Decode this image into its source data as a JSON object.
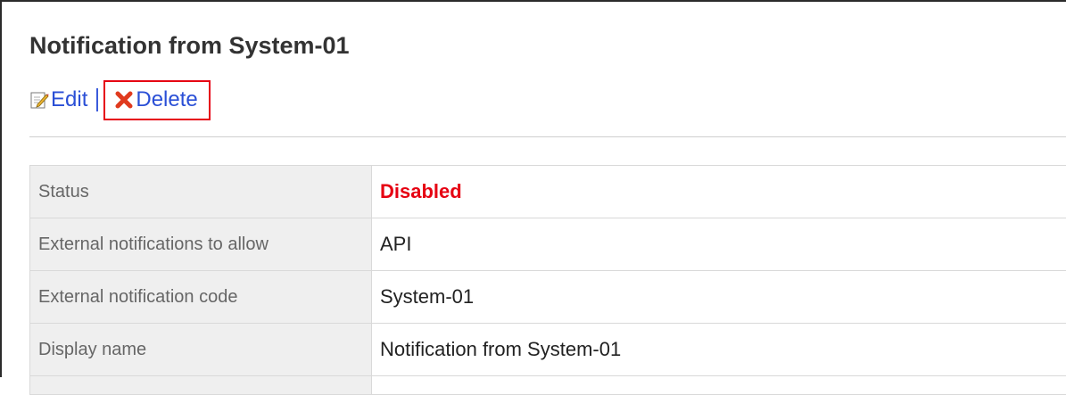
{
  "page": {
    "title": "Notification from System-01"
  },
  "actions": {
    "edit_label": "Edit",
    "edit_icon": "edit-icon",
    "delete_label": "Delete",
    "delete_icon": "delete-x-icon",
    "highlight_color": "#e60012"
  },
  "details": {
    "rows": [
      {
        "label": "Status",
        "value": "Disabled",
        "value_color": "#e60012"
      },
      {
        "label": "External notifications to allow",
        "value": "API"
      },
      {
        "label": "External notification code",
        "value": "System-01"
      },
      {
        "label": "Display name",
        "value": "Notification from System-01"
      }
    ]
  },
  "colors": {
    "link": "#2a4fd6",
    "label_bg": "#efefef",
    "border": "#d9d9d9"
  }
}
